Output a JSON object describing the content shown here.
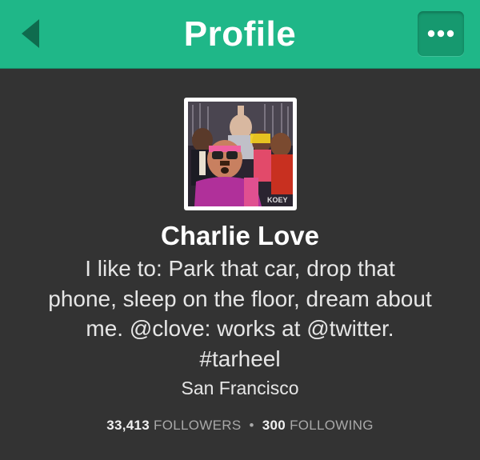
{
  "header": {
    "title": "Profile",
    "back_icon": "chevron-left-icon",
    "more_icon": "ellipsis-icon",
    "accent_color": "#1fb788"
  },
  "profile": {
    "name": "Charlie Love",
    "bio_lines": [
      "I like to: Park that car, drop that",
      "phone, sleep on the floor, dream about",
      "me. @clove: works at @twitter.",
      "#tarheel"
    ],
    "location": "San Francisco",
    "avatar_watermark": "KOEY"
  },
  "stats": {
    "followers_count": "33,413",
    "followers_label": "FOLLOWERS",
    "separator": "•",
    "following_count": "300",
    "following_label": "FOLLOWING"
  }
}
